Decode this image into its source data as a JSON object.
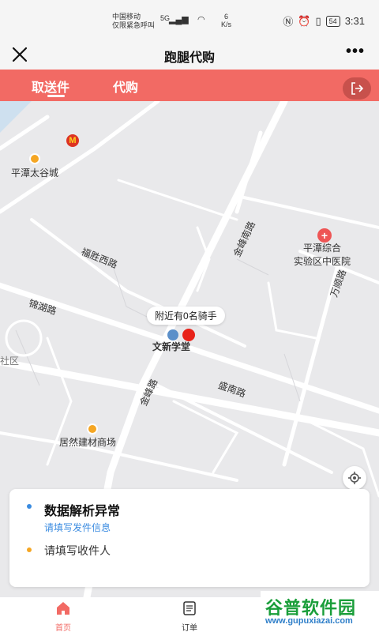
{
  "status_bar": {
    "carrier_line1": "中国移动",
    "carrier_line2": "仅限紧急呼叫",
    "network": "5G",
    "speed_value": "6",
    "speed_unit": "K/s",
    "battery": "54",
    "time": "3:31"
  },
  "nav": {
    "title": "跑腿代购",
    "more": "•••"
  },
  "tabs": [
    {
      "label": "取送件",
      "active": true
    },
    {
      "label": "代购",
      "active": false
    }
  ],
  "map": {
    "riders_tip": "附近有0名骑手",
    "labels": {
      "pingtan_taigu": "平潭太谷城",
      "fusheng_road": "福胜西路",
      "jinhu_road": "锦湖路",
      "jinfeng_road_1": "金峰南路",
      "jinfeng_road_2": "金峰路",
      "wenxin_school": "文新学堂",
      "shengnan_road": "盛南路",
      "juran_mall": "居然建材商场",
      "hospital_1": "平潭综合",
      "hospital_2": "实验区中医院",
      "wanshun_road": "万顺路",
      "community": "社区"
    }
  },
  "card": {
    "error_title": "数据解析异常",
    "error_sub": "请填写发件信息",
    "receiver_placeholder": "请填写收件人"
  },
  "bottom_nav": {
    "home": "首页",
    "orders": "订单"
  },
  "watermark": {
    "logo": "谷普软件园",
    "url": "www.gupuxiazai.com"
  },
  "colors": {
    "accent": "#f26a64",
    "link": "#3a8be0",
    "pin": "#e8231a"
  }
}
